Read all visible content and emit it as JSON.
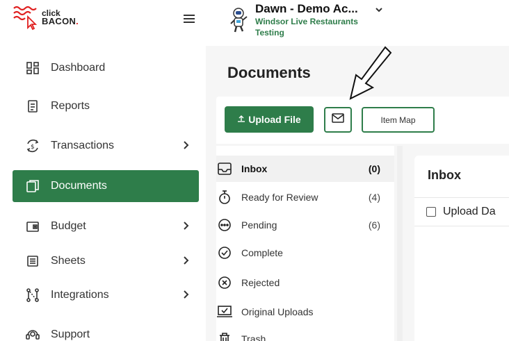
{
  "brand": {
    "line1": "click",
    "line2": "BACON",
    "dot": "."
  },
  "sidebar": {
    "items": [
      {
        "label": "Dashboard",
        "icon": "dashboard-icon"
      },
      {
        "label": "Reports",
        "icon": "reports-icon"
      },
      {
        "label": "Transactions",
        "icon": "transactions-icon",
        "expandable": true
      },
      {
        "label": "Documents",
        "icon": "documents-icon",
        "active": true
      },
      {
        "label": "Budget",
        "icon": "budget-icon",
        "expandable": true
      },
      {
        "label": "Sheets",
        "icon": "sheets-icon",
        "expandable": true
      },
      {
        "label": "Integrations",
        "icon": "integrations-icon",
        "expandable": true
      },
      {
        "label": "Support",
        "icon": "support-icon"
      }
    ]
  },
  "account": {
    "name": "Dawn - Demo Ac...",
    "subtitle": "Windsor Live Restaurants Testing"
  },
  "page": {
    "title": "Documents"
  },
  "toolbar": {
    "upload_label": "Upload File",
    "item_map_label": "Item Map"
  },
  "folders": [
    {
      "label": "Inbox",
      "count": "(0)",
      "icon": "inbox-icon",
      "active": true
    },
    {
      "label": "Ready for Review",
      "count": "(4)",
      "icon": "stopwatch-icon"
    },
    {
      "label": "Pending",
      "count": "(6)",
      "icon": "pending-dots-icon"
    },
    {
      "label": "Complete",
      "count": "",
      "icon": "check-circle-icon"
    },
    {
      "label": "Rejected",
      "count": "",
      "icon": "x-circle-icon"
    },
    {
      "label": "Original Uploads",
      "count": "",
      "icon": "laptop-check-icon"
    },
    {
      "label": "Trash",
      "count": "",
      "icon": "trash-icon"
    }
  ],
  "inbox": {
    "title": "Inbox",
    "column_header": "Upload Da"
  },
  "colors": {
    "accent": "#2e7d4a",
    "brand_red": "#e02020"
  }
}
